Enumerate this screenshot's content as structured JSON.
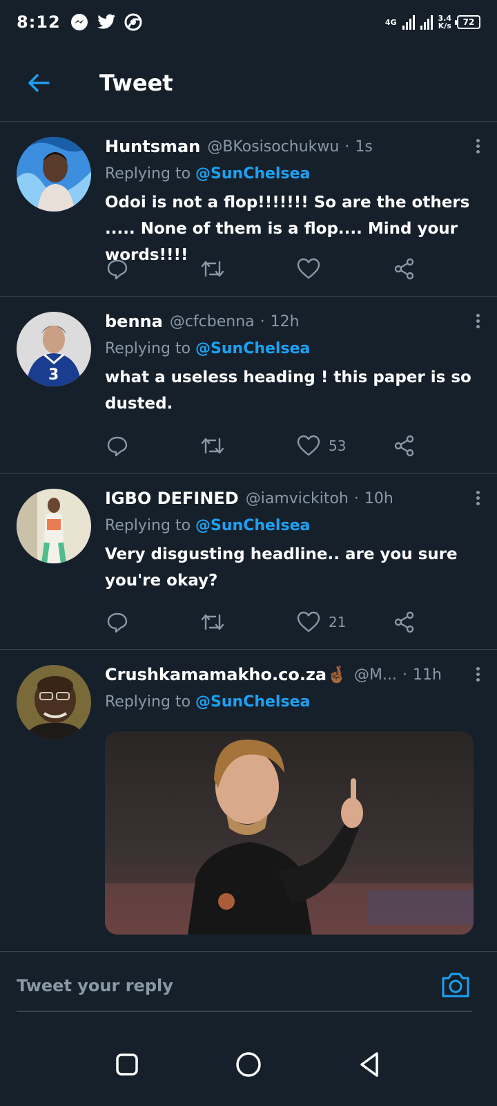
{
  "status_bar": {
    "time": "8:12",
    "network": "4G",
    "speed_value": "3.4",
    "speed_unit": "K/s",
    "battery": "72"
  },
  "header": {
    "title": "Tweet"
  },
  "tweets": [
    {
      "name": "Huntsman",
      "handle": "@BKosisochukwu",
      "time": "1s",
      "replying_prefix": "Replying to",
      "replying_to": "@SunChelsea",
      "text": "Odoi is not a flop!!!!!!! So are the others ..... None of them is a flop.... Mind your words!!!!",
      "likes": ""
    },
    {
      "name": "benna",
      "handle": "@cfcbenna",
      "time": "12h",
      "replying_prefix": "Replying to",
      "replying_to": "@SunChelsea",
      "text": "what a useless heading ! this paper is so dusted.",
      "likes": "53"
    },
    {
      "name": "IGBO DEFINED",
      "handle": "@iamvickitoh",
      "time": "10h",
      "replying_prefix": "Replying to",
      "replying_to": "@SunChelsea",
      "text": "Very disgusting headline.. are you sure you're okay?",
      "likes": "21"
    },
    {
      "name": "Crushkamamakho.co.za🤞🏾",
      "handle": "@M...",
      "time": "11h",
      "replying_prefix": "Replying to",
      "replying_to": "@SunChelsea"
    }
  ],
  "reply_box": {
    "placeholder": "Tweet your reply"
  },
  "icons": {
    "back": "arrow-left-icon",
    "reply": "reply-bubble-icon",
    "retweet": "retweet-icon",
    "like": "heart-icon",
    "share": "share-icon",
    "camera": "camera-icon"
  },
  "colors": {
    "background": "#15202b",
    "accent": "#1da1f2",
    "secondary_text": "#8899a6",
    "divider": "#38444d"
  }
}
